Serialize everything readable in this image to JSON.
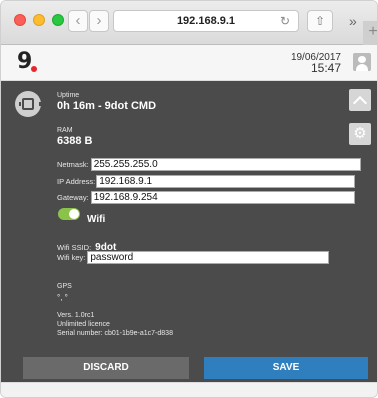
{
  "browser": {
    "url": "192.168.9.1",
    "back_glyph": "‹",
    "forward_glyph": "›",
    "reload_glyph": "↻",
    "share_glyph": "⇧",
    "more_glyph": "»",
    "newtab_glyph": "+"
  },
  "header": {
    "logo": "9",
    "date": "19/06/2017",
    "time": "15:47"
  },
  "device": {
    "uptime_label": "Uptime",
    "uptime_value": "0h 16m - 9dot CMD",
    "ram_label": "RAM",
    "ram_value": "6388 B"
  },
  "network": {
    "netmask_label": "Netmask:",
    "netmask_value": "255.255.255.0",
    "ip_label": "IP Address:",
    "ip_value": "192.168.9.1",
    "gateway_label": "Gateway:",
    "gateway_value": "192.168.9.254"
  },
  "wifi": {
    "label": "Wifi",
    "enabled": true,
    "ssid_label": "Wifi SSID:",
    "ssid_value": "9dot",
    "key_label": "Wifi key:",
    "key_value": "password"
  },
  "gps": {
    "label": "GPS",
    "value": "°, °"
  },
  "info": {
    "version": "Vers. 1.0rc1",
    "licence": "Unlimited licence",
    "serial": "Serial number: cb01-1b9e-a1c7-d838"
  },
  "actions": {
    "discard_label": "DISCARD",
    "save_label": "SAVE"
  },
  "colors": {
    "panel_bg": "#4b4b4b",
    "save_blue": "#2f7fbf",
    "discard_gray": "#6a6a6a",
    "toggle_green": "#8bc34a",
    "logo_dot_red": "#e8262b"
  }
}
